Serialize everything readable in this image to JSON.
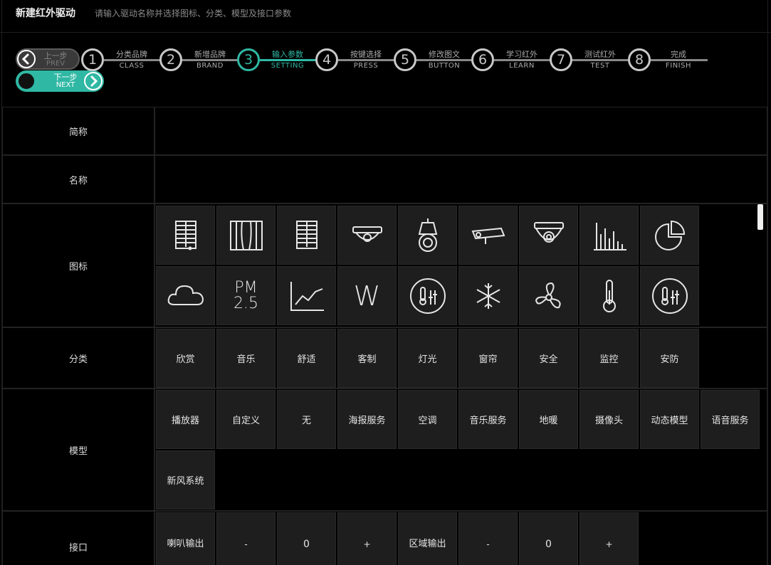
{
  "header": {
    "title": "新建红外驱动",
    "hint": "请输入驱动名称并选择图标、分类、模型及接口参数"
  },
  "nav": {
    "prev_cn": "上一步",
    "prev_en": "PREV",
    "next_cn": "下一步",
    "next_en": "NEXT"
  },
  "steps": [
    {
      "num": "1",
      "cn": "分类品牌",
      "en": "CLASS"
    },
    {
      "num": "2",
      "cn": "新增品牌",
      "en": "BRAND"
    },
    {
      "num": "3",
      "cn": "输入参数",
      "en": "SETTING"
    },
    {
      "num": "4",
      "cn": "按键选择",
      "en": "PRESS"
    },
    {
      "num": "5",
      "cn": "修改图文",
      "en": "BUTTON"
    },
    {
      "num": "6",
      "cn": "学习红外",
      "en": "LEARN"
    },
    {
      "num": "7",
      "cn": "测试红外",
      "en": "TEST"
    },
    {
      "num": "8",
      "cn": "完成",
      "en": "FINISH"
    }
  ],
  "active_step": 3,
  "colors": {
    "accent": "#2fb8a4",
    "tile": "#1e1e1e"
  },
  "form": {
    "short_name_label": "简称",
    "short_name_value": "",
    "name_label": "名称",
    "name_value": "",
    "icon_label": "图标",
    "icons": [
      "blind-icon",
      "curtain-icon",
      "shutter-icon",
      "dome-camera-icon",
      "ptz-camera-icon",
      "bullet-camera-icon",
      "eyeball-camera-icon",
      "bar-chart-icon",
      "pie-chart-icon",
      "cloud-icon",
      "pm25-icon",
      "line-chart-icon",
      "watt-icon",
      "thermo-control-icon",
      "snowflake-icon",
      "fan-icon",
      "thermometer-icon",
      "thermo-control-icon"
    ],
    "pm_top": "PM",
    "pm_bottom": "2.5",
    "watt": "W",
    "category_label": "分类",
    "categories": [
      "欣赏",
      "音乐",
      "舒适",
      "客制",
      "灯光",
      "窗帘",
      "安全",
      "监控",
      "安防"
    ],
    "model_label": "模型",
    "models": [
      "播放器",
      "自定义",
      "无",
      "海报服务",
      "空调",
      "音乐服务",
      "地暖",
      "摄像头",
      "动态模型",
      "语音服务",
      "新风系统"
    ],
    "interface_label": "接口",
    "interface": [
      "喇叭输出",
      "-",
      "0",
      "+",
      "区域输出",
      "-",
      "0",
      "+"
    ]
  }
}
